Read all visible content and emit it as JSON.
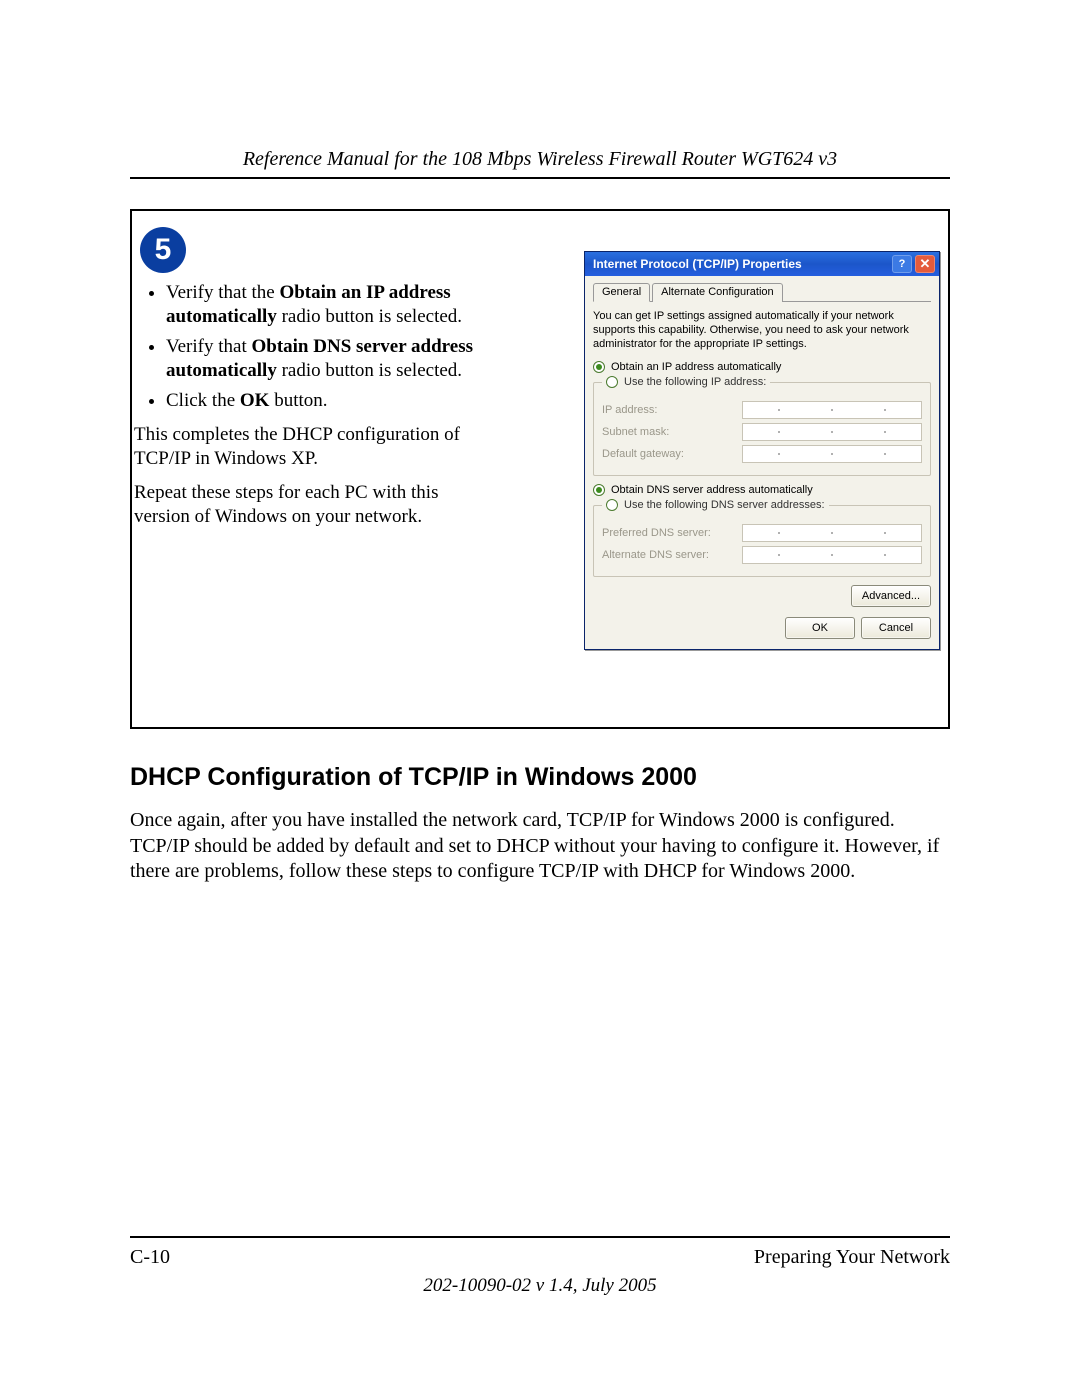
{
  "running_head": "Reference Manual for the 108 Mbps Wireless Firewall Router WGT624 v3",
  "step": {
    "number": "5",
    "bullet1_pre": "Verify that the ",
    "bullet1_bold": "Obtain an IP address automatically",
    "bullet1_post": " radio button is selected.",
    "bullet2_pre": "Verify that ",
    "bullet2_bold": "Obtain DNS server address automatically",
    "bullet2_post": " radio button is selected.",
    "bullet3_pre": "Click the ",
    "bullet3_bold": "OK",
    "bullet3_post": " button.",
    "para1": "This completes the DHCP configuration of TCP/IP in Windows XP.",
    "para2": "Repeat these steps for each PC with this version of Windows on your network."
  },
  "dialog": {
    "title": "Internet Protocol (TCP/IP) Properties",
    "help_glyph": "?",
    "close_glyph": "✕",
    "tab_general": "General",
    "tab_alt": "Alternate Configuration",
    "desc": "You can get IP settings assigned automatically if your network supports this capability. Otherwise, you need to ask your network administrator for the appropriate IP settings.",
    "radio_ip_auto": "Obtain an IP address automatically",
    "radio_ip_manual": "Use the following IP address:",
    "lbl_ip": "IP address:",
    "lbl_subnet": "Subnet mask:",
    "lbl_gateway": "Default gateway:",
    "radio_dns_auto": "Obtain DNS server address automatically",
    "radio_dns_manual": "Use the following DNS server addresses:",
    "lbl_pref_dns": "Preferred DNS server:",
    "lbl_alt_dns": "Alternate DNS server:",
    "btn_advanced": "Advanced...",
    "btn_ok": "OK",
    "btn_cancel": "Cancel"
  },
  "section_heading": "DHCP Configuration of TCP/IP in Windows 2000",
  "section_body": "Once again, after you have installed the network card, TCP/IP for Windows 2000 is configured. TCP/IP should be added by default and set to DHCP without your having to configure it. However, if there are problems, follow these steps to configure TCP/IP with DHCP for Windows 2000.",
  "footer": {
    "page_no": "C-10",
    "section": "Preparing Your Network",
    "docline": "202-10090-02 v 1.4, July 2005"
  }
}
